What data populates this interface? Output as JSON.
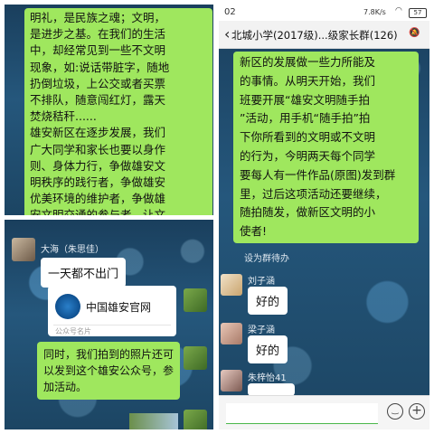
{
  "panel_tl": {
    "text": "明礼，是民族之魂；文明，\n是进步之基。在我们的生活\n中，却经常见到一些不文明\n现象，如:说话带脏字，随地\n扔倒垃圾，上公交或者买票\n不排队，随意闯红灯，露天\n焚烧秸秆......\n雄安新区在逐步发展，我们\n广大同学和家长也要以身作\n则、身体力行，争做雄安文\n明秩序的践行者，争做雄安\n优美环境的维护者，争做雄\n安文明交通的参与者，让文\n明之花开遍雄安大地，推动"
  },
  "panel_bl": {
    "sender_name": "大海（朱思佳）",
    "message1": "一天都不出门",
    "card_title": "中国雄安官网",
    "card_footer": "公众号名片",
    "message2": "同时，我们拍到的照片还可\n以发到这个雄安公众号，参\n加活动。"
  },
  "panel_r": {
    "status_time": "02",
    "status_speed": "7.8K/s",
    "status_battery": "57",
    "group_title": "北城小学(2017级)...级家长群(126)",
    "main_text": "新区的发展做一些力所能及\n的事情。从明天开始，我们\n班要开展“雄安文明随手拍\n”活动，用手机“随手拍”拍\n下你所看到的文明或不文明\n的行为，今明两天每个同学\n要每人有一件作品(原图)发到群\n里，过后这项活动还要继续，\n随拍随发，做新区文明的小\n使者!",
    "pending": "设为群待办",
    "reply1_name": "刘子涵",
    "reply1_text": "好的",
    "reply2_name": "梁子涵",
    "reply2_text": "好的",
    "reply3_name": "朱梓怡41"
  },
  "icons": [
    "back-arrow-icon",
    "group-icon",
    "emoji-icon",
    "add-icon",
    "wifi-icon",
    "battery-icon",
    "mute-icon",
    "chevron-icon"
  ]
}
